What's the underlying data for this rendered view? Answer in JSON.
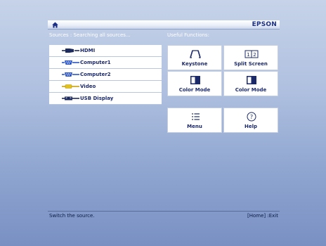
{
  "header": {
    "brand": "EPSON",
    "home_icon": "home-icon"
  },
  "sources": {
    "label": "Sources : Searching all sources...",
    "items": [
      {
        "label": "HDMI",
        "icon": "hdmi-icon",
        "icon_color": "#1d2a5e"
      },
      {
        "label": "Computer1",
        "icon": "computer1-icon",
        "icon_color": "#2b55c6"
      },
      {
        "label": "Computer2",
        "icon": "computer2-icon",
        "icon_color": "#2b55c6"
      },
      {
        "label": "Video",
        "icon": "video-icon",
        "icon_color": "#e2c21d"
      },
      {
        "label": "USB Display",
        "icon": "usb-icon",
        "icon_color": "#1d2a5e"
      }
    ]
  },
  "functions": {
    "label": "Useful Functions:",
    "items": [
      {
        "label": "Keystone",
        "icon": "keystone-icon"
      },
      {
        "label": "Split Screen",
        "icon": "split-screen-icon",
        "icon_text": "1 2"
      },
      {
        "label": "Color Mode",
        "icon": "color-mode-icon"
      },
      {
        "label": "Color Mode",
        "icon": "color-mode-icon"
      },
      {
        "label": "Menu",
        "icon": "menu-icon"
      },
      {
        "label": "Help",
        "icon": "help-icon",
        "icon_text": "?"
      }
    ]
  },
  "footer": {
    "status": "Switch the source.",
    "exit_hint": "[Home] :Exit"
  }
}
